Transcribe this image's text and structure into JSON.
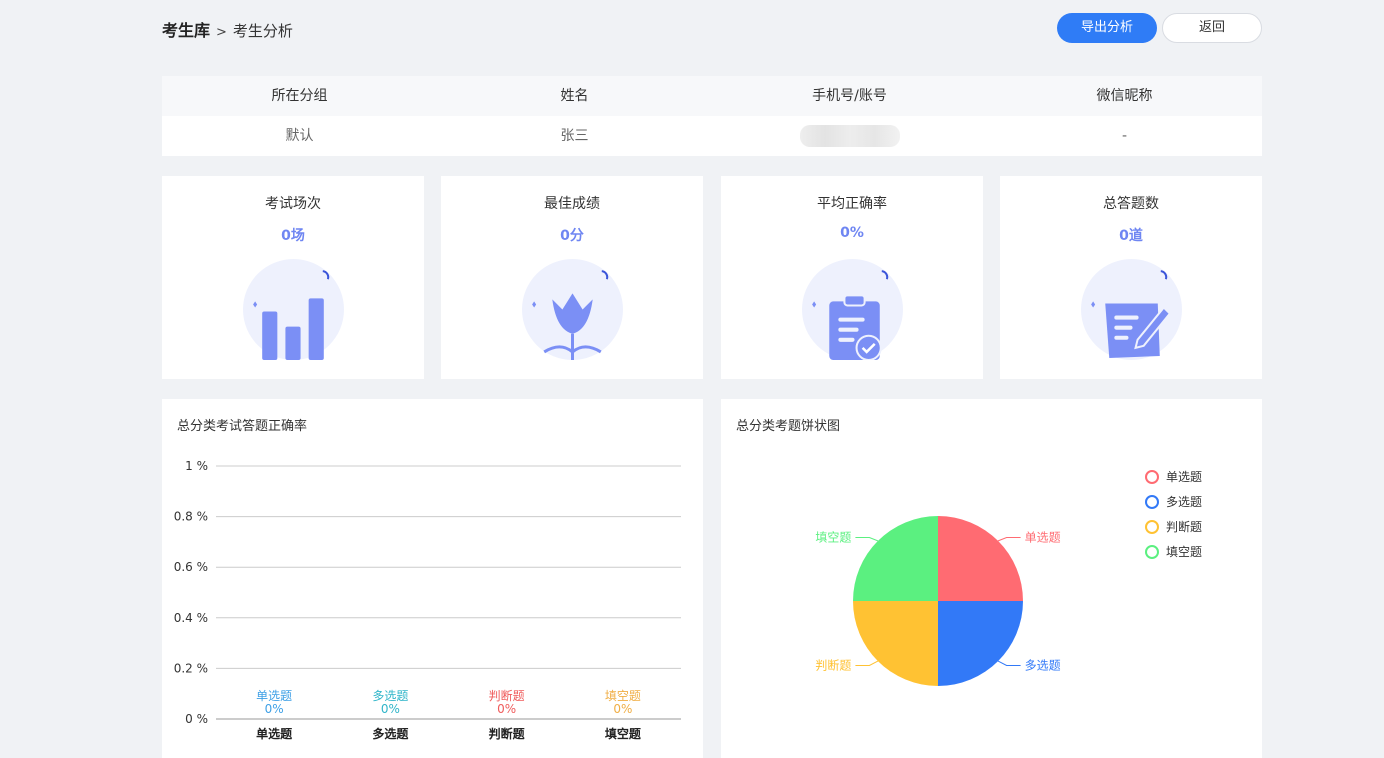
{
  "breadcrumb": {
    "root": "考生库",
    "separator": ">",
    "current": "考生分析"
  },
  "actions": {
    "export_label": "导出分析",
    "back_label": "返回"
  },
  "info_table": {
    "columns": [
      "所在分组",
      "姓名",
      "手机号/账号",
      "微信昵称"
    ],
    "row": {
      "group": "默认",
      "name": "张三",
      "phone": "",
      "wechat": "-"
    }
  },
  "stats": [
    {
      "label": "考试场次",
      "value": "0场",
      "icon": "bar-chart-icon"
    },
    {
      "label": "最佳成绩",
      "value": "0分",
      "icon": "tulip-icon"
    },
    {
      "label": "平均正确率",
      "value": "0%",
      "icon": "clipboard-check-icon"
    },
    {
      "label": "总答题数",
      "value": "0道",
      "icon": "notepad-pen-icon"
    }
  ],
  "colors": {
    "accent": "#2f7cf6",
    "stat_value": "#6f86f2",
    "icon_fill": "#7b8ff5",
    "icon_bg": "#eef1fd"
  },
  "chart_data": [
    {
      "type": "bar",
      "title": "总分类考试答题正确率",
      "categories": [
        "单选题",
        "多选题",
        "判断题",
        "填空题"
      ],
      "values": [
        0,
        0,
        0,
        0
      ],
      "value_labels": [
        "0%",
        "0%",
        "0%",
        "0%"
      ],
      "label_colors": [
        "#3ea0e6",
        "#2fb5c9",
        "#ef5b5b",
        "#f0ae45"
      ],
      "yticks": [
        "0 %",
        "0.2 %",
        "0.4 %",
        "0.6 %",
        "0.8 %",
        "1 %"
      ],
      "ylim": [
        0,
        1
      ],
      "grid": true
    },
    {
      "type": "pie",
      "title": "总分类考题饼状图",
      "series": [
        {
          "name": "单选题",
          "value": 25,
          "color": "#ff6b72"
        },
        {
          "name": "多选题",
          "value": 25,
          "color": "#3279f7"
        },
        {
          "name": "判断题",
          "value": 25,
          "color": "#ffc233"
        },
        {
          "name": "填空题",
          "value": 25,
          "color": "#5bf080"
        }
      ],
      "legend": "top-right"
    }
  ]
}
